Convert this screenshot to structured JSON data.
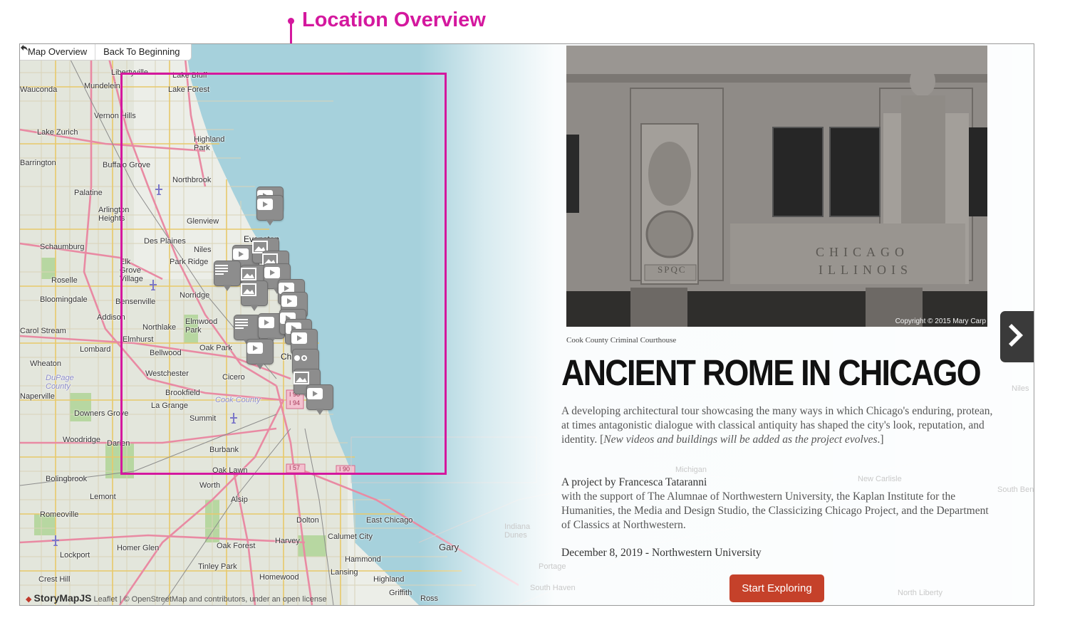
{
  "annotation": {
    "label": "Location Overview",
    "color": "#d4189e"
  },
  "toolbar": {
    "map_overview": "Map Overview",
    "back_to_beginning": "Back To Beginning",
    "back_icon": "return-arrow-icon"
  },
  "map": {
    "water_color": "#a6d1dc",
    "places": [
      "Libertyville",
      "Lake Bluff",
      "Mundelein",
      "Lake Forest",
      "Wauconda",
      "Vernon Hills",
      "Lake Zurich",
      "Highland Park",
      "Barrington",
      "Buffalo Grove",
      "Northbrook",
      "Palatine",
      "Arlington Heights",
      "Glenview",
      "Evanston",
      "Schaumburg",
      "Des Plaines",
      "Niles",
      "Elk Grove Village",
      "Park Ridge",
      "Roselle",
      "Norridge",
      "Bloomingdale",
      "Bensenville",
      "Addison",
      "Carol Stream",
      "Northlake",
      "Elmwood Park",
      "Oak Park",
      "Elmhurst",
      "Lombard",
      "Bellwood",
      "Wheaton",
      "DuPage County",
      "Westchester",
      "Cicero",
      "Brookfield",
      "Naperville",
      "La Grange",
      "Cook County",
      "Downers Grove",
      "Summit",
      "Woodridge",
      "Darien",
      "Burbank",
      "Oak Lawn",
      "Bolingbrook",
      "Worth",
      "Lemont",
      "Alsip",
      "Romeoville",
      "Dolton",
      "East Chicago",
      "Calumet City",
      "Harvey",
      "Homer Glen",
      "Oak Forest",
      "Gary",
      "Lockport",
      "Tinley Park",
      "Hammond",
      "Homewood",
      "Crest Hill",
      "Lansing",
      "Highland",
      "Griffith",
      "Ross",
      "Chicago",
      "Michigan",
      "New Carlisle",
      "South Bend",
      "Niles",
      "Portage",
      "Indiana Dunes",
      "South Haven",
      "North Liberty"
    ],
    "highways": [
      "I 90",
      "I 94",
      "I 57",
      "I 90"
    ],
    "markers": [
      "video",
      "video",
      "text",
      "image",
      "video",
      "image",
      "image",
      "video",
      "text",
      "video",
      "video",
      "video",
      "gallery",
      "image",
      "video"
    ]
  },
  "credit": {
    "brand": "StoryMapJS",
    "text": "Leaflet | © OpenStreetMap and contributors, under an open license"
  },
  "slide": {
    "photo_copyright": "Copyright © 2015 Mary Carp",
    "photo_inscription_1": "CHICAGO",
    "photo_inscription_2": "ILLINOIS",
    "photo_plaque": "SPQC",
    "caption": "Cook County Criminal Courthouse",
    "title": "ANCIENT ROME IN CHICAGO",
    "desc_main": "A developing architectural tour showcasing the many ways in which Chicago's enduring, protean, at times antagonistic dialogue with classical antiquity has shaped the city's look, reputation, and identity. [",
    "desc_italic": "New videos and buildings will be added as the project evolves",
    "desc_end": ".]",
    "author": "A project by Francesca Tataranni",
    "support": "with the support of The Alumnae of Northwestern University, the Kaplan Institute for the Humanities, the Media and Design Studio, the Classicizing Chicago Project, and the Department of Classics at Northwestern.",
    "date": "December 8, 2019 - Northwestern University",
    "button": "Start Exploring",
    "button_color": "#c5412a",
    "next_icon": "chevron-right-icon"
  }
}
